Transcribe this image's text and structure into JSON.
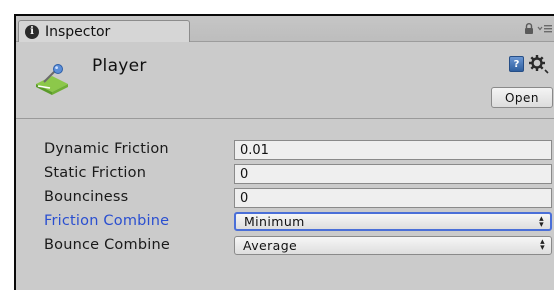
{
  "window": {
    "tab_label": "Inspector",
    "tab_icon": "info-icon"
  },
  "header": {
    "object_name": "Player",
    "icon": "physic-material-icon",
    "open_label": "Open"
  },
  "properties": {
    "dynamic_friction": {
      "label": "Dynamic Friction",
      "value": "0.01"
    },
    "static_friction": {
      "label": "Static Friction",
      "value": "0"
    },
    "bounciness": {
      "label": "Bounciness",
      "value": "0"
    },
    "friction_combine": {
      "label": "Friction Combine",
      "value": "Minimum",
      "focused": true
    },
    "bounce_combine": {
      "label": "Bounce Combine",
      "value": "Average"
    }
  },
  "colors": {
    "panel_bg": "#cbcbcb",
    "active_label": "#2a4fd0",
    "focus_border": "#4a6fd8"
  }
}
